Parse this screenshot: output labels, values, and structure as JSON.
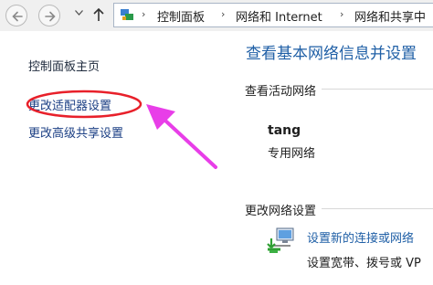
{
  "breadcrumb": [
    "控制面板",
    "网络和 Internet",
    "网络和共享中"
  ],
  "left_pane": {
    "home": "控制面板主页",
    "change_adapter": "更改适配器设置",
    "change_sharing": "更改高级共享设置"
  },
  "main": {
    "title": "查看基本网络信息并设置",
    "active_networks_label": "查看活动网络",
    "network_name": "tang",
    "network_type": "专用网络",
    "change_settings_label": "更改网络设置",
    "setup_link": "设置新的连接或网络",
    "setup_desc": "设置宽带、拨号或 VP"
  },
  "icons": {
    "back": "back-arrow-icon",
    "forward": "forward-arrow-icon",
    "up": "up-arrow-icon",
    "address": "control-panel-icon",
    "setup": "network-setup-icon"
  },
  "colors": {
    "link": "#1f5fa6",
    "annotation_ellipse": "#e8202a",
    "annotation_arrow": "#e83ee8"
  }
}
